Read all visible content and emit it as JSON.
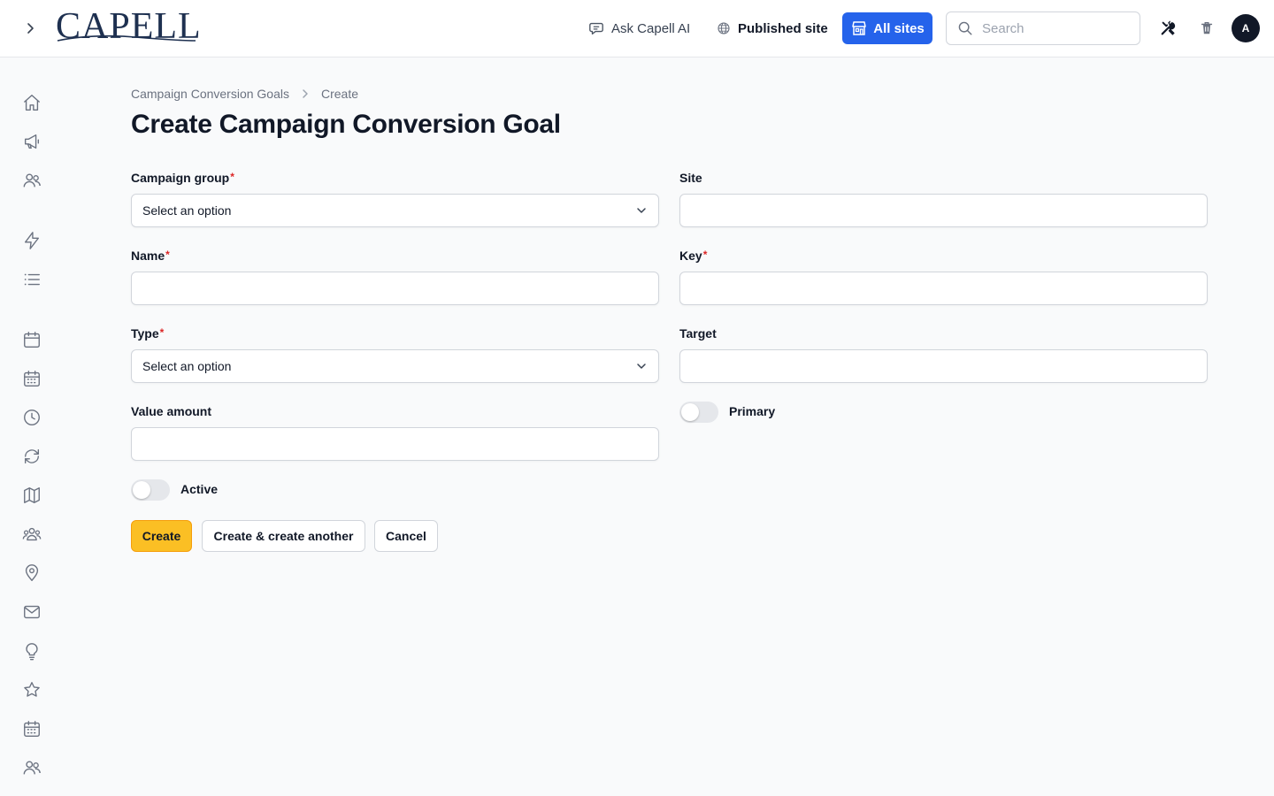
{
  "app": {
    "logo_text": "CAPELL"
  },
  "header": {
    "ask_ai_label": "Ask Capell AI",
    "published_site_label": "Published site",
    "all_sites_label": "All sites",
    "search_placeholder": "Search",
    "avatar_initial": "A",
    "accent_color": "#2563eb"
  },
  "sidebar": {
    "items": [
      {
        "name": "home-icon"
      },
      {
        "name": "megaphone-icon"
      },
      {
        "name": "users-icon"
      },
      {
        "name": "bolt-icon"
      },
      {
        "name": "list-icon"
      },
      {
        "name": "calendar-icon"
      },
      {
        "name": "calendar-days-icon"
      },
      {
        "name": "clock-icon"
      },
      {
        "name": "refresh-icon"
      },
      {
        "name": "map-icon"
      },
      {
        "name": "user-group-icon"
      },
      {
        "name": "map-pin-icon"
      },
      {
        "name": "envelope-icon"
      },
      {
        "name": "lightbulb-icon"
      },
      {
        "name": "star-icon"
      },
      {
        "name": "calendar-days-icon"
      },
      {
        "name": "users-icon"
      }
    ]
  },
  "breadcrumb": {
    "parent": "Campaign Conversion Goals",
    "current": "Create"
  },
  "page": {
    "title": "Create Campaign Conversion Goal"
  },
  "form": {
    "campaign_group": {
      "label": "Campaign group",
      "required": "*",
      "value": "Select an option"
    },
    "site": {
      "label": "Site",
      "value": ""
    },
    "name": {
      "label": "Name",
      "required": "*",
      "value": ""
    },
    "key": {
      "label": "Key",
      "required": "*",
      "value": ""
    },
    "type": {
      "label": "Type",
      "required": "*",
      "value": "Select an option"
    },
    "target": {
      "label": "Target",
      "value": ""
    },
    "value_amount": {
      "label": "Value amount",
      "value": ""
    },
    "primary": {
      "label": "Primary",
      "on": false
    },
    "active": {
      "label": "Active",
      "on": false
    }
  },
  "actions": {
    "create_label": "Create",
    "create_another_label": "Create & create another",
    "cancel_label": "Cancel",
    "primary_color": "#fbbf24"
  }
}
